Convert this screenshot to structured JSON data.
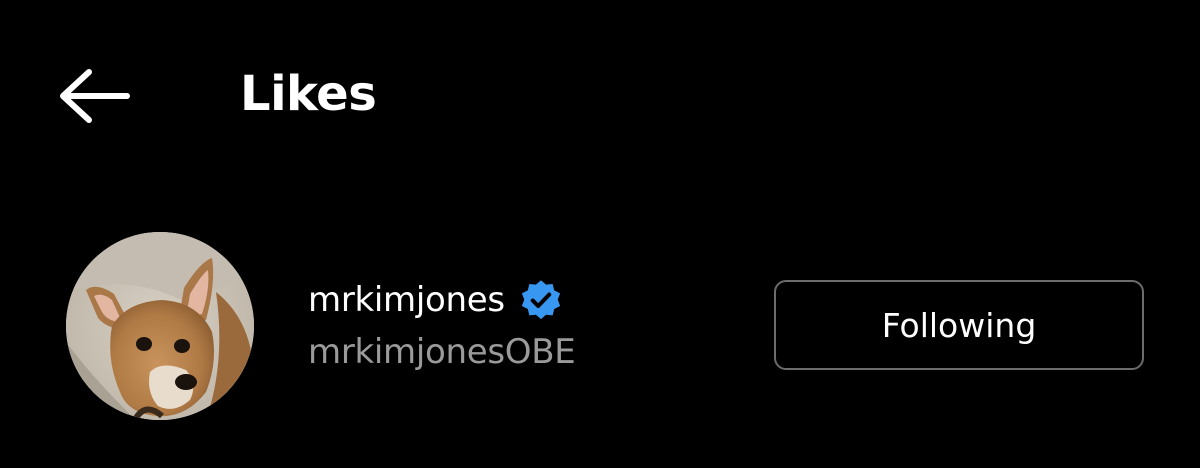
{
  "header": {
    "title": "Likes",
    "back_icon": "arrow-left-icon"
  },
  "likes": [
    {
      "username": "mrkimjones",
      "full_name": "mrkimjonesOBE",
      "verified": true,
      "verified_icon": "verified-badge-icon",
      "verified_color": "#3897f0",
      "follow_button_label": "Following"
    }
  ],
  "colors": {
    "background": "#000000",
    "primary_text": "#ffffff",
    "secondary_text": "#9a9a9a",
    "button_border": "#6c6c6c"
  }
}
